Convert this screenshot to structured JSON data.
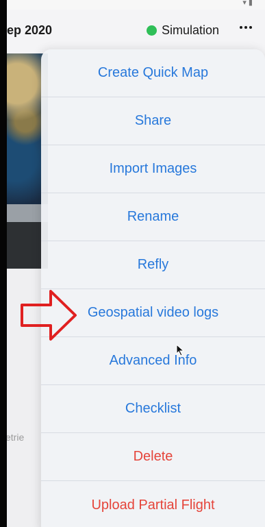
{
  "header": {
    "title": "ep 2020",
    "mode_label": "Simulation",
    "mode_color": "#2fbf58"
  },
  "background": {
    "retries_text": "etrie"
  },
  "menu": {
    "items": [
      {
        "label": "Create Quick Map",
        "style": "normal"
      },
      {
        "label": "Share",
        "style": "normal"
      },
      {
        "label": "Import Images",
        "style": "normal"
      },
      {
        "label": "Rename",
        "style": "normal"
      },
      {
        "label": "Refly",
        "style": "normal"
      },
      {
        "label": "Geospatial video logs",
        "style": "normal"
      },
      {
        "label": "Advanced Info",
        "style": "normal"
      },
      {
        "label": "Checklist",
        "style": "normal"
      },
      {
        "label": "Delete",
        "style": "danger"
      },
      {
        "label": "Upload Partial Flight",
        "style": "danger"
      }
    ]
  },
  "colors": {
    "accent": "#2778db",
    "danger": "#e5443a",
    "annotation": "#e02020"
  },
  "icons": {
    "more": "ellipsis-icon",
    "callout": "arrow-right-icon",
    "pointer": "cursor-icon"
  }
}
